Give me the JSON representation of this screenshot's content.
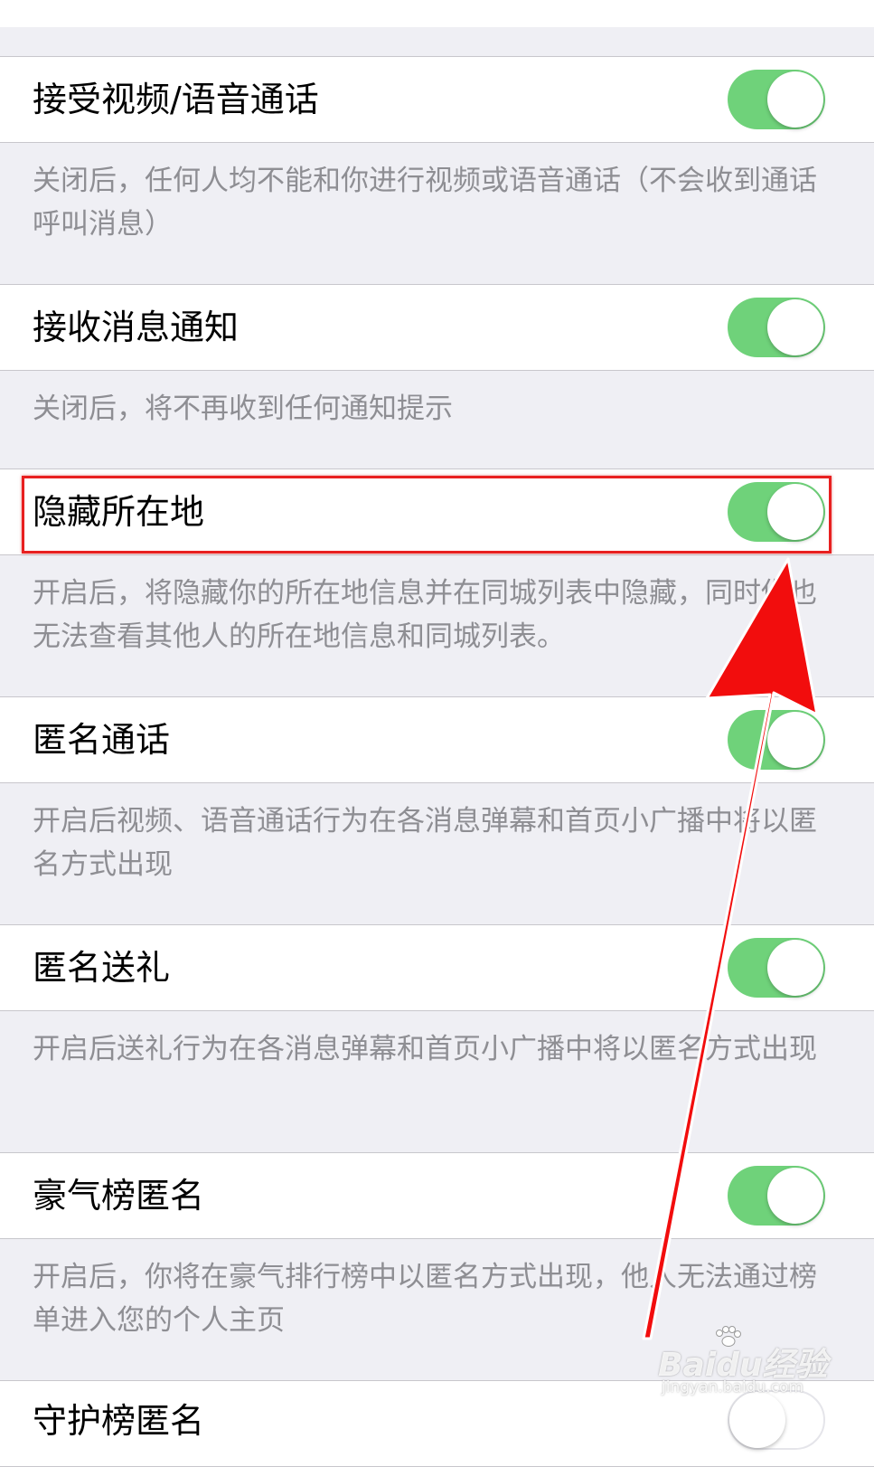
{
  "settings": [
    {
      "label": "接受视频/语音通话",
      "enabled": true,
      "description": "关闭后，任何人均不能和你进行视频或语音通话（不会收到通话呼叫消息）"
    },
    {
      "label": "接收消息通知",
      "enabled": true,
      "description": "关闭后，将不再收到任何通知提示"
    },
    {
      "label": "隐藏所在地",
      "enabled": true,
      "description": "开启后，将隐藏你的所在地信息并在同城列表中隐藏，同时你也无法查看其他人的所在地信息和同城列表。"
    },
    {
      "label": "匿名通话",
      "enabled": true,
      "description": "开启后视频、语音通话行为在各消息弹幕和首页小广播中将以匿名方式出现"
    },
    {
      "label": "匿名送礼",
      "enabled": true,
      "description": "开启后送礼行为在各消息弹幕和首页小广播中将以匿名方式出现"
    },
    {
      "label": "豪气榜匿名",
      "enabled": true,
      "description": "开启后，你将在豪气排行榜中以匿名方式出现，他人无法通过榜单进入您的个人主页"
    },
    {
      "label": "守护榜匿名",
      "enabled": false
    }
  ],
  "annotation": {
    "highlighted_item": "隐藏所在地",
    "color": "#e82020"
  },
  "watermark": {
    "brand": "Baidu经验",
    "site": "jingyan.baidu.com"
  },
  "colors": {
    "toggle_on": "#6fd27a",
    "background": "#efeff4",
    "description_text": "#8e8e93"
  }
}
